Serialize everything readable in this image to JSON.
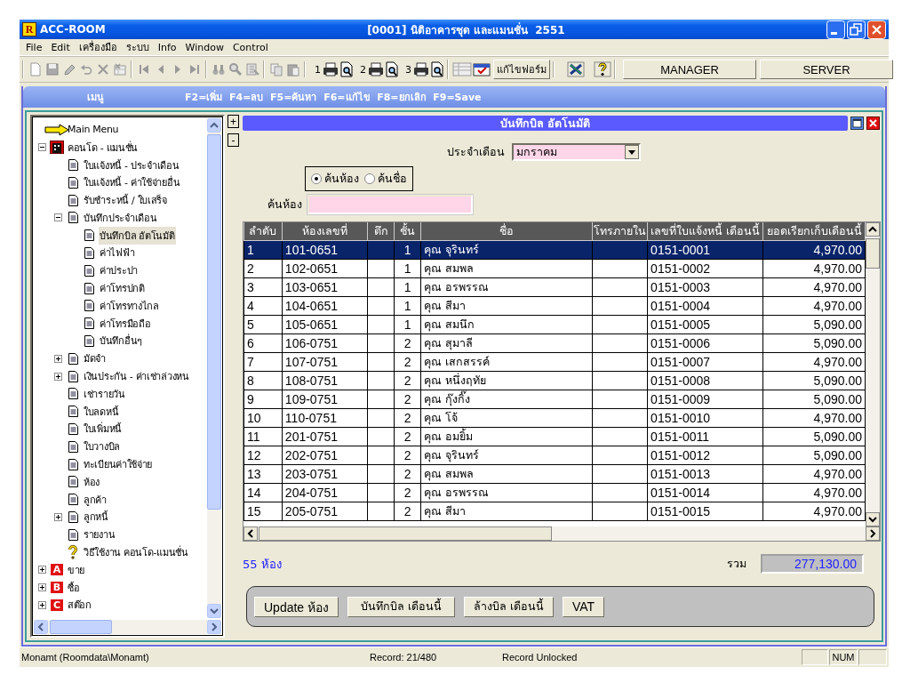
{
  "window": {
    "logo": "R",
    "title": "ACC-ROOM",
    "document_title": "[0001] นิติอาคารชุด และแมนชั่น  2551"
  },
  "menu": [
    "File",
    "Edit",
    "เครื่องมือ",
    "ระบบ",
    "Info",
    "Window",
    "Control"
  ],
  "toolbar": {
    "print_groups": [
      "1",
      "2",
      "3"
    ],
    "form_button": "แก้ไขฟอร์ม",
    "buttons": [
      "MANAGER",
      "SERVER"
    ]
  },
  "hint_bar": {
    "title": "เมนู",
    "keys": "F2=เพิ่ม  F4=ลบ  F5=ค้นหา  F6=แก้ไข  F8=ยกเลิก  F9=Save"
  },
  "tree_buttons": [
    "+",
    "-"
  ],
  "tree": {
    "items": [
      {
        "label": "Main Menu",
        "kind": "arrow",
        "selected": false
      },
      {
        "label": "คอนโด - แมนชั่น",
        "kind": "building",
        "selected": false,
        "expanded": true,
        "children": [
          {
            "label": "ใบแจ้งหนี้ - ประจำเดือน",
            "kind": "page",
            "selected": false
          },
          {
            "label": "ใบแจ้งหนี้ - ค่าใช้จ่ายอื่น",
            "kind": "page",
            "selected": false
          },
          {
            "label": "รับชำระหนี้ / ใบเสร็จ",
            "kind": "page",
            "selected": false
          },
          {
            "label": "บันทึกประจำเดือน",
            "kind": "page",
            "selected": false,
            "expanded": true,
            "children": [
              {
                "label": "บันทึกบิล อัตโนมัติ",
                "kind": "page",
                "selected": true
              },
              {
                "label": "ค่าไฟฟ้า",
                "kind": "page",
                "selected": false
              },
              {
                "label": "ค่าประปา",
                "kind": "page",
                "selected": false
              },
              {
                "label": "ค่าโทรปกติ",
                "kind": "page",
                "selected": false
              },
              {
                "label": "ค่าโทรทางไกล",
                "kind": "page",
                "selected": false
              },
              {
                "label": "ค่าโทรมือถือ",
                "kind": "page",
                "selected": false
              },
              {
                "label": "บันทึกอื่นๆ",
                "kind": "page",
                "selected": false
              }
            ]
          },
          {
            "label": "มัดจำ",
            "kind": "page",
            "selected": false,
            "expanded": false
          },
          {
            "label": "เงินประกัน - ค่าเช่าล่วงหน",
            "kind": "page",
            "selected": false,
            "expanded": false
          },
          {
            "label": "เช่ารายวัน",
            "kind": "page",
            "selected": false
          },
          {
            "label": "ใบลดหนี้",
            "kind": "page",
            "selected": false
          },
          {
            "label": "ใบเพิ่มหนี้",
            "kind": "page",
            "selected": false
          },
          {
            "label": "ใบวางบิล",
            "kind": "page",
            "selected": false
          },
          {
            "label": "ทะเบียนค่าใช้จ่าย",
            "kind": "page",
            "selected": false
          },
          {
            "label": "ห้อง",
            "kind": "page",
            "selected": false
          },
          {
            "label": "ลูกค้า",
            "kind": "page",
            "selected": false
          },
          {
            "label": "ลูกหนี้",
            "kind": "page",
            "selected": false,
            "expanded": false
          },
          {
            "label": "รายงาน",
            "kind": "page",
            "selected": false
          },
          {
            "label": "วิธีใช้งาน คอนโด-แมนชั่น",
            "kind": "help",
            "selected": false
          }
        ]
      },
      {
        "label": "ขาย",
        "kind": "letter",
        "badge": "A",
        "selected": false,
        "expanded": false
      },
      {
        "label": "ซื้อ",
        "kind": "letter",
        "badge": "B",
        "selected": false,
        "expanded": false
      },
      {
        "label": "สต๊อก",
        "kind": "letter",
        "badge": "C",
        "selected": false,
        "expanded": false
      }
    ]
  },
  "form": {
    "title": "บันทึกบิล อัตโนมัติ",
    "month_label": "ประจำเดือน",
    "month_value": "มกราคม",
    "search_modes": [
      {
        "label": "ค้นห้อง",
        "selected": true
      },
      {
        "label": "ค้นชื่อ",
        "selected": false
      }
    ],
    "search_label": "ค้นห้อง"
  },
  "table": {
    "columns": [
      "ลำดับ",
      "ห้องเลขที่",
      "ตึก",
      "ชั้น",
      "ชื่อ",
      "โทรภายใน",
      "เลขที่ใบแจ้งหนี้ เดือนนี้",
      "ยอดเรียกเก็บเดือนนี้"
    ],
    "rows": [
      {
        "no": "1",
        "room": "101-0651",
        "floor": "1",
        "name": "คุณ จุรินทร์",
        "invoice": "0151-0001",
        "amount": "4,970.00",
        "selected": true
      },
      {
        "no": "2",
        "room": "102-0651",
        "floor": "1",
        "name": "คุณ สมพล",
        "invoice": "0151-0002",
        "amount": "4,970.00",
        "selected": false
      },
      {
        "no": "3",
        "room": "103-0651",
        "floor": "1",
        "name": "คุณ อรพรรณ",
        "invoice": "0151-0003",
        "amount": "4,970.00",
        "selected": false
      },
      {
        "no": "4",
        "room": "104-0651",
        "floor": "1",
        "name": "คุณ สีมา",
        "invoice": "0151-0004",
        "amount": "4,970.00",
        "selected": false
      },
      {
        "no": "5",
        "room": "105-0651",
        "floor": "1",
        "name": "คุณ สมนึก",
        "invoice": "0151-0005",
        "amount": "5,090.00",
        "selected": false
      },
      {
        "no": "6",
        "room": "106-0751",
        "floor": "2",
        "name": "คุณ สุมาลี",
        "invoice": "0151-0006",
        "amount": "5,090.00",
        "selected": false
      },
      {
        "no": "7",
        "room": "107-0751",
        "floor": "2",
        "name": "คุณ เสกสรรค์",
        "invoice": "0151-0007",
        "amount": "4,970.00",
        "selected": false
      },
      {
        "no": "8",
        "room": "108-0751",
        "floor": "2",
        "name": "คุณ หนึ่งฤทัย",
        "invoice": "0151-0008",
        "amount": "5,090.00",
        "selected": false
      },
      {
        "no": "9",
        "room": "109-0751",
        "floor": "2",
        "name": "คุณ กุ๊งกิ๊ง",
        "invoice": "0151-0009",
        "amount": "5,090.00",
        "selected": false
      },
      {
        "no": "10",
        "room": "110-0751",
        "floor": "2",
        "name": "คุณ โจ้",
        "invoice": "0151-0010",
        "amount": "4,970.00",
        "selected": false
      },
      {
        "no": "11",
        "room": "201-0751",
        "floor": "2",
        "name": "คุณ อมยิ้ม",
        "invoice": "0151-0011",
        "amount": "5,090.00",
        "selected": false
      },
      {
        "no": "12",
        "room": "202-0751",
        "floor": "2",
        "name": "คุณ จุรินทร์",
        "invoice": "0151-0012",
        "amount": "5,090.00",
        "selected": false
      },
      {
        "no": "13",
        "room": "203-0751",
        "floor": "2",
        "name": "คุณ สมพล",
        "invoice": "0151-0013",
        "amount": "4,970.00",
        "selected": false
      },
      {
        "no": "14",
        "room": "204-0751",
        "floor": "2",
        "name": "คุณ อรพรรณ",
        "invoice": "0151-0014",
        "amount": "4,970.00",
        "selected": false
      },
      {
        "no": "15",
        "room": "205-0751",
        "floor": "2",
        "name": "คุณ สีมา",
        "invoice": "0151-0015",
        "amount": "4,970.00",
        "selected": false
      }
    ]
  },
  "summary": {
    "count": "55 ห้อง",
    "total_label": "รวม",
    "total": "277,130.00"
  },
  "actions": [
    "Update ห้อง",
    "บันทึกบิล เดือนนี้",
    "ล้างบิล เดือนนี้",
    "VAT"
  ],
  "status_bar": {
    "source": "Monamt (Roomdata\\Monamt)",
    "record": "Record: 21/480",
    "lock": "Record Unlocked",
    "keys": [
      "NUM"
    ]
  }
}
